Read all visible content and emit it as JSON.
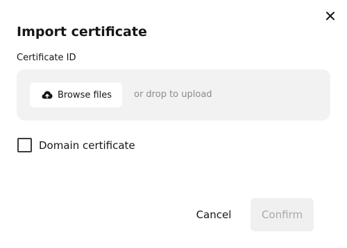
{
  "dialog": {
    "title": "Import certificate",
    "close_icon": "close-icon"
  },
  "field": {
    "label": "Certificate ID"
  },
  "upload": {
    "browse_label": "Browse files",
    "browse_icon": "cloud-upload-icon",
    "hint": "or drop to upload"
  },
  "options": {
    "domain_certificate_label": "Domain certificate",
    "domain_certificate_checked": false
  },
  "actions": {
    "cancel_label": "Cancel",
    "confirm_label": "Confirm",
    "confirm_disabled": true
  },
  "colors": {
    "text": "#161616",
    "dropzone_bg": "#f2f2f2",
    "hint_text": "#8a8a8a",
    "disabled_bg": "#f0f0f0",
    "disabled_text": "#a8a8a8"
  }
}
